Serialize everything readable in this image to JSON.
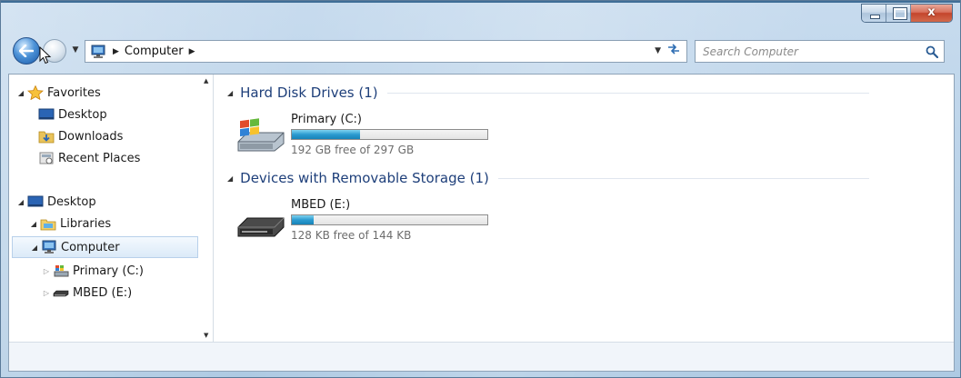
{
  "window": {
    "caption_buttons": {
      "close_label": "x"
    }
  },
  "address_bar": {
    "segments": [
      "Computer"
    ],
    "search_placeholder": "Search Computer"
  },
  "nav_pane": {
    "items": [
      {
        "label": "Favorites",
        "icon": "star-icon",
        "expanded": true
      },
      {
        "label": "Desktop",
        "icon": "desktop-icon"
      },
      {
        "label": "Downloads",
        "icon": "downloads-folder-icon"
      },
      {
        "label": "Recent Places",
        "icon": "recent-places-icon"
      },
      {
        "label": "Desktop",
        "icon": "desktop-icon",
        "expanded": true
      },
      {
        "label": "Libraries",
        "icon": "libraries-icon",
        "expanded": true
      },
      {
        "label": "Computer",
        "icon": "computer-icon",
        "expanded": true,
        "selected": true
      },
      {
        "label": "Primary (C:)",
        "icon": "windows-drive-icon",
        "expanded": false
      },
      {
        "label": "MBED (E:)",
        "icon": "removable-drive-icon",
        "expanded": false
      }
    ]
  },
  "groups": [
    {
      "title": "Hard Disk Drives (1)",
      "drives": [
        {
          "name": "Primary (C:)",
          "free_text": "192 GB free of 297 GB",
          "used_fraction": 0.35,
          "icon": "windows-drive-icon"
        }
      ]
    },
    {
      "title": "Devices with Removable Storage (1)",
      "drives": [
        {
          "name": "MBED (E:)",
          "free_text": "128 KB free of 144 KB",
          "used_fraction": 0.11,
          "icon": "removable-drive-icon"
        }
      ]
    }
  ],
  "colors": {
    "group_header": "#1e3f7a",
    "bar_fill": "#2c9bd0",
    "selection": "#dbeaf8"
  }
}
